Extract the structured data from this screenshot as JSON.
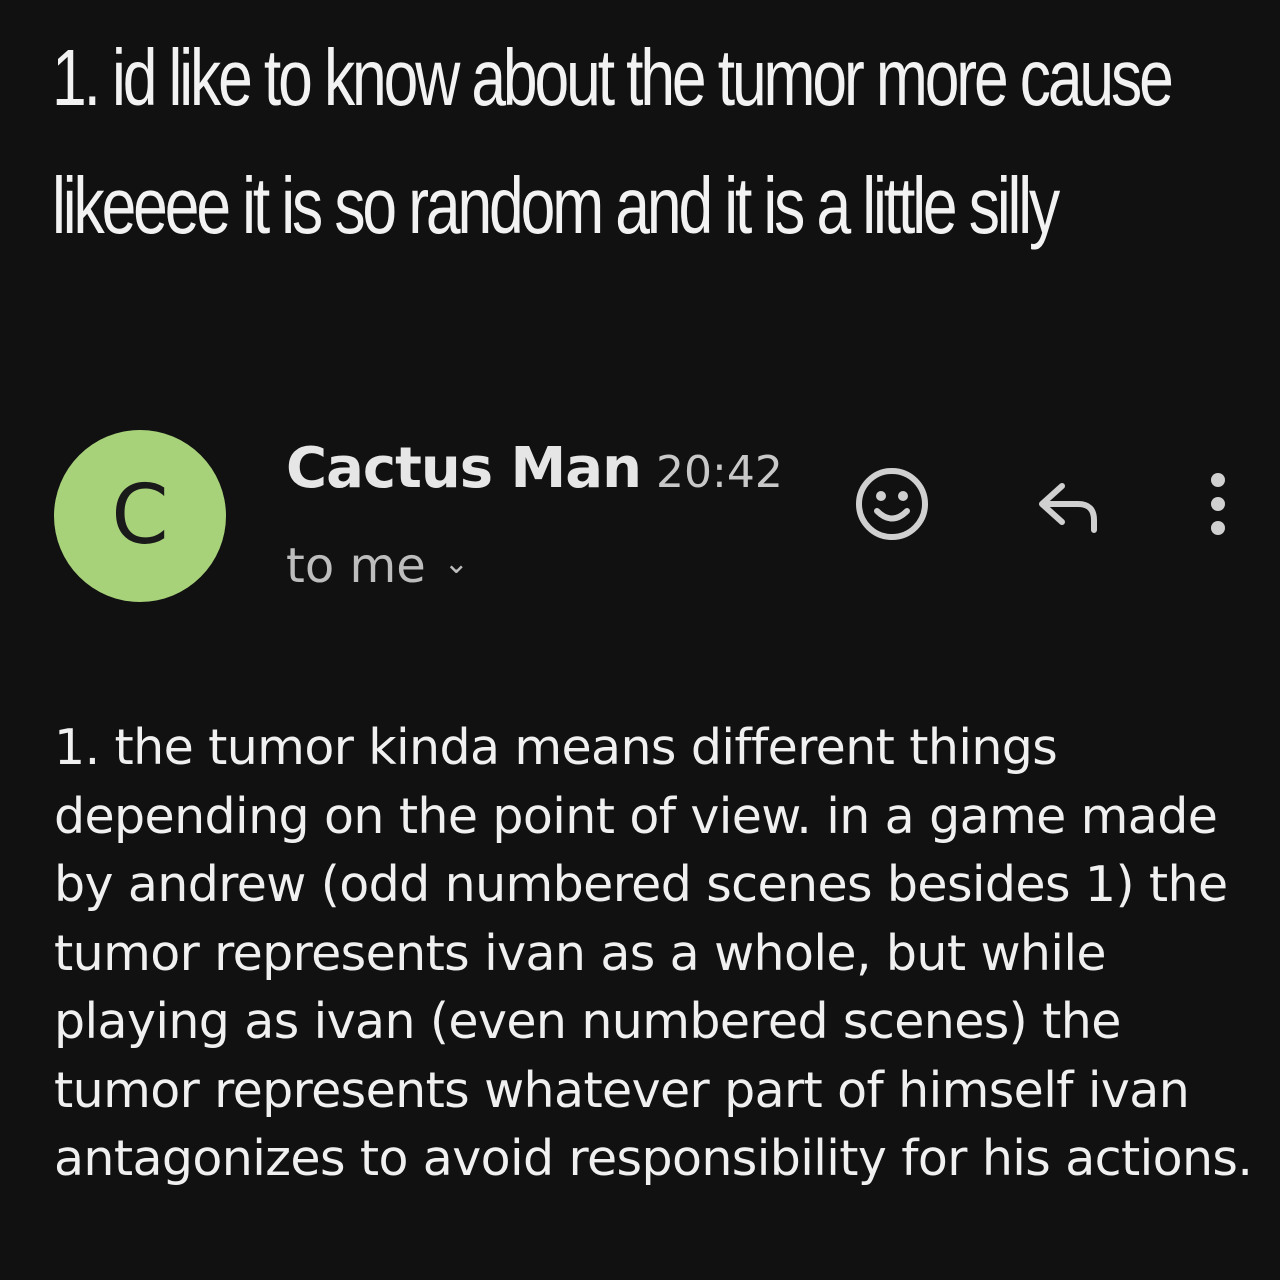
{
  "quoted_message": "1. id like to know about the tumor more cause likeeee it is so random and it is a little silly",
  "email": {
    "avatar_letter": "C",
    "avatar_color": "#a8d27a",
    "sender_name": "Cactus Man",
    "time": "20:42",
    "recipient": "to me",
    "actions": [
      "smiley-icon",
      "reply-icon",
      "more-vert-icon"
    ],
    "body": "1. the tumor kinda means different things depending on the point of view. in a game made by andrew (odd numbered scenes besides 1) the tumor represents ivan as a whole, but while playing as ivan (even numbered scenes) the tumor represents whatever part of himself ivan antagonizes to avoid responsibility for his actions."
  }
}
